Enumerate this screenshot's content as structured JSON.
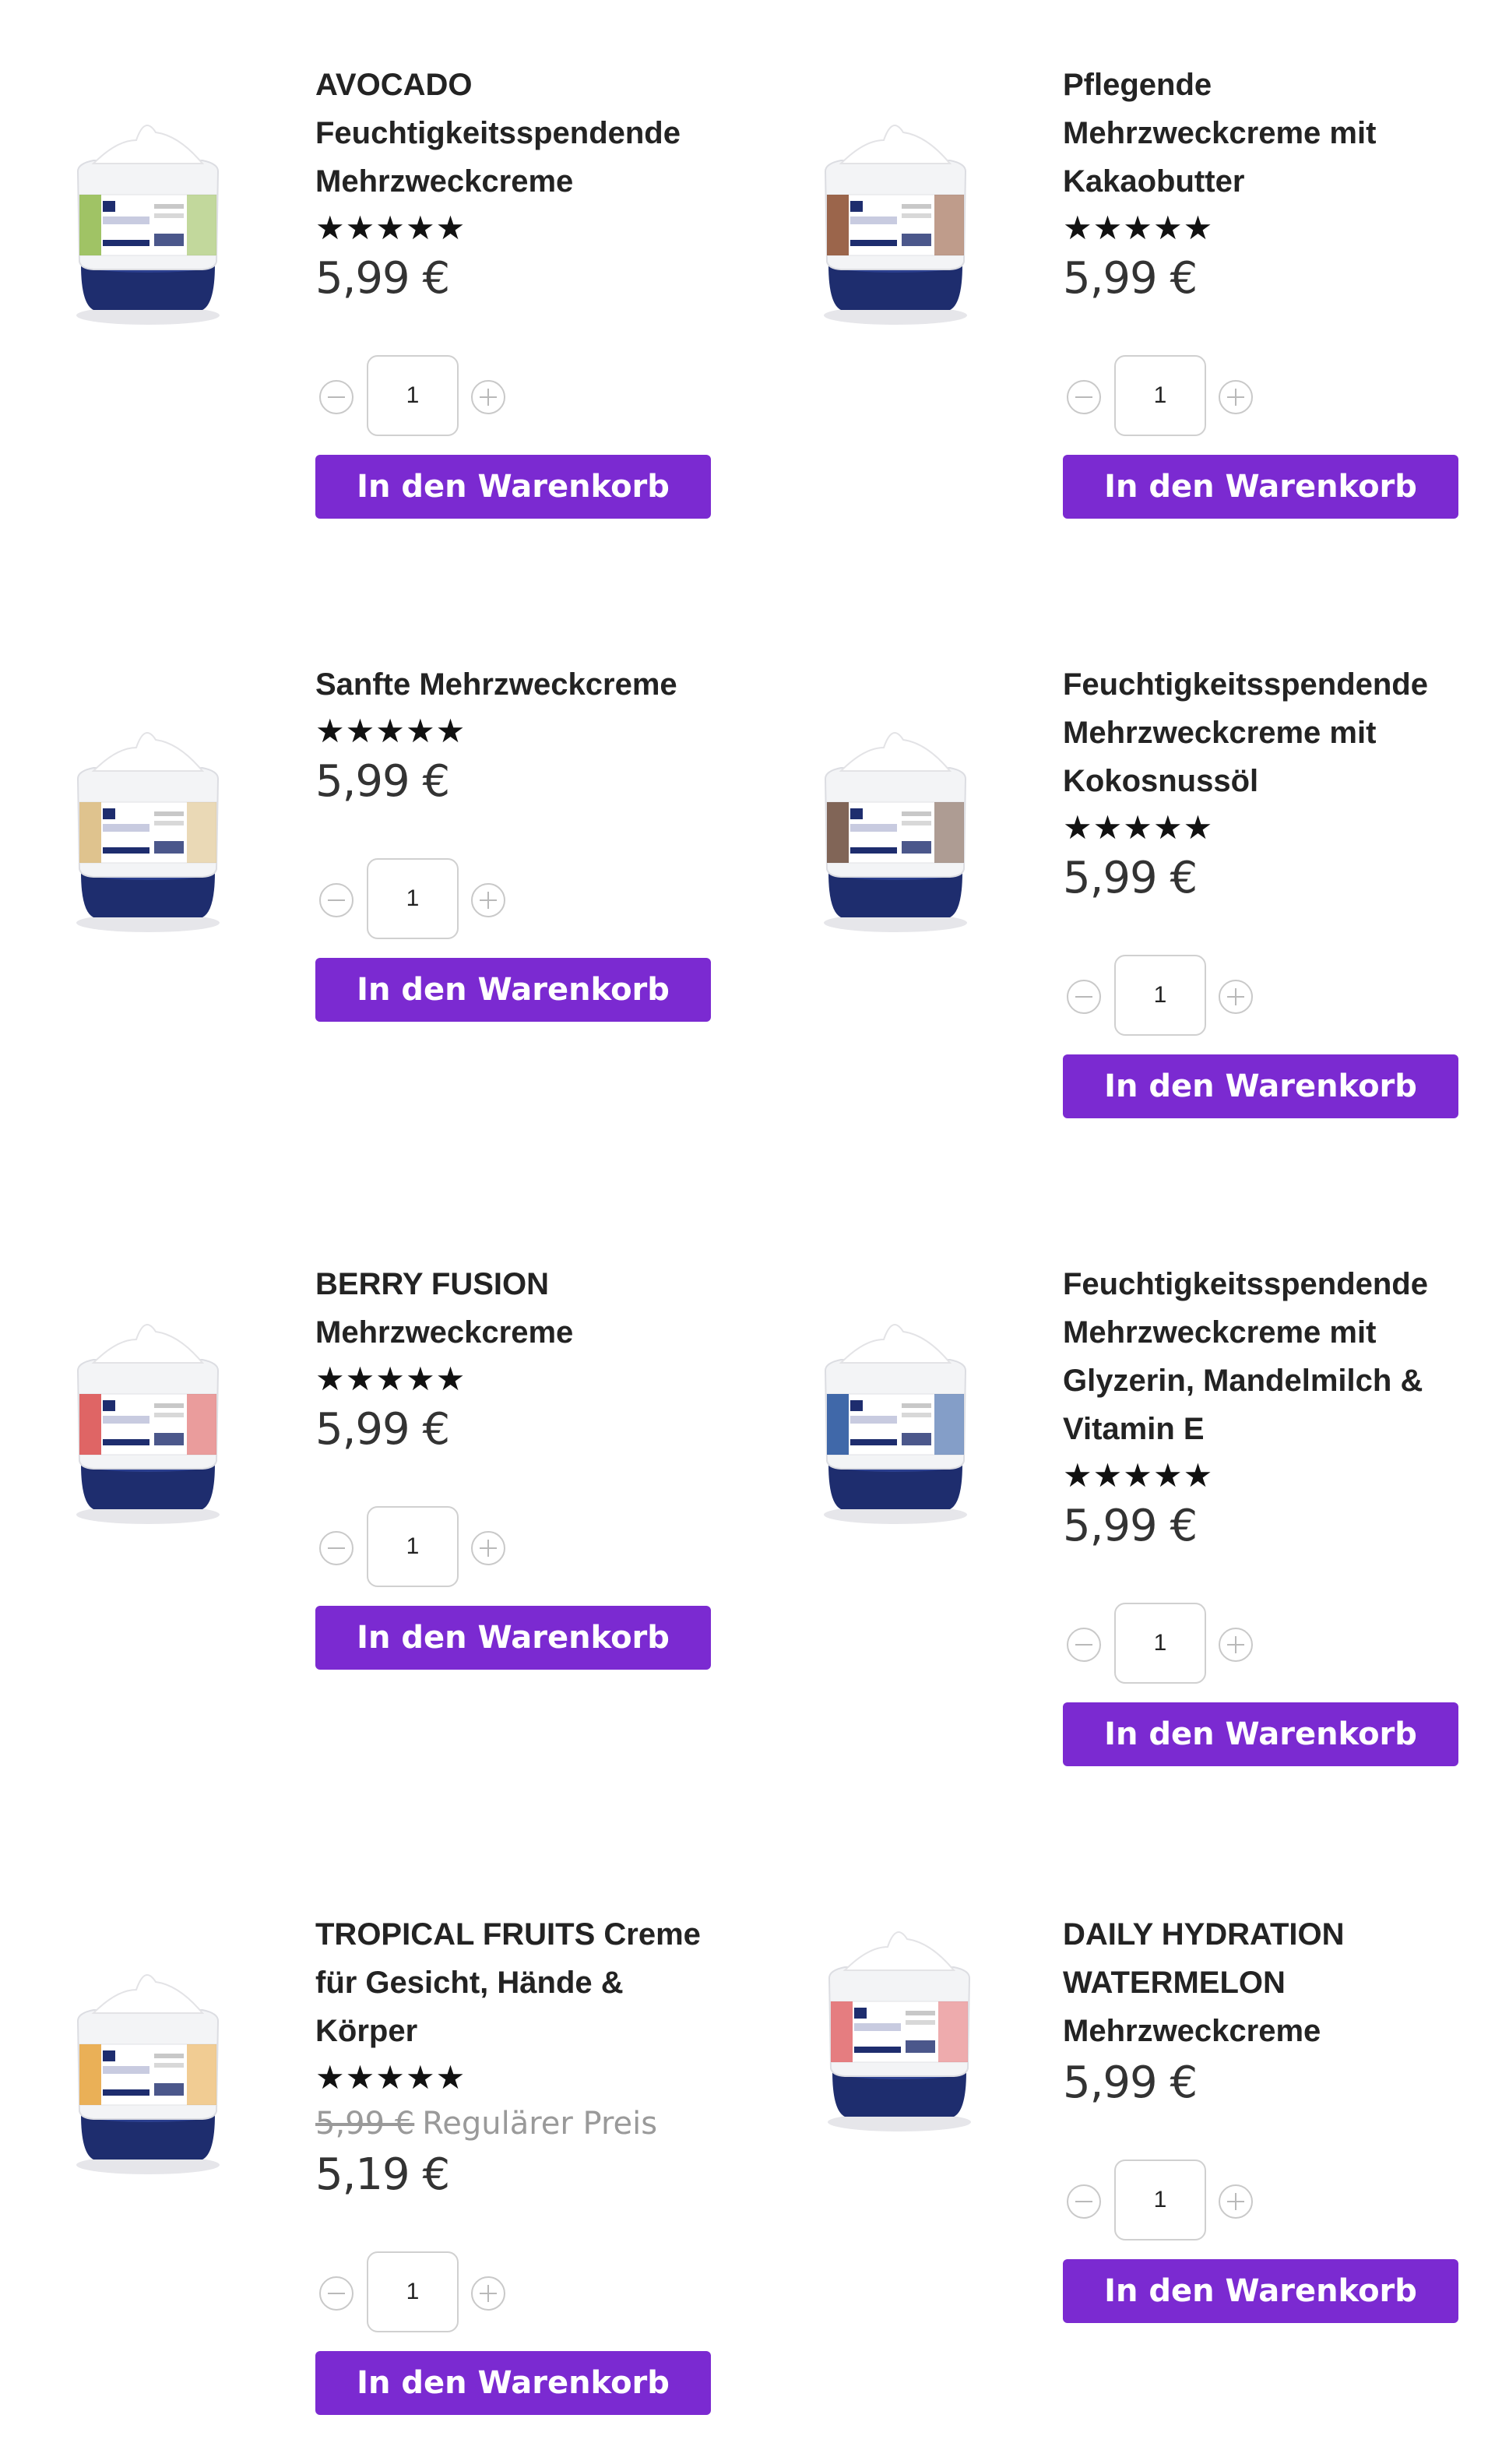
{
  "products": [
    {
      "title_lines": [
        "AVOCADO",
        "Feuchtigkeitsspendende",
        "Mehrzweckcreme"
      ],
      "stars": "★★★★★",
      "price": "5,99 €",
      "qty": "1",
      "cart_label": "In den Warenkorb",
      "label_color": "#8fb84a"
    },
    {
      "title_lines": [
        "Pflegende",
        "Mehrzweckcreme mit",
        "Kakaobutter"
      ],
      "stars": "★★★★★",
      "price": "5,99 €",
      "qty": "1",
      "cart_label": "In den Warenkorb",
      "label_color": "#8a4a2c"
    },
    {
      "title_lines": [
        "Sanfte Mehrzweckcreme"
      ],
      "stars": "★★★★★",
      "price": "5,99 €",
      "qty": "1",
      "cart_label": "In den Warenkorb",
      "label_color": "#d9b97a"
    },
    {
      "title_lines": [
        "Feuchtigkeitsspendende",
        "Mehrzweckcreme mit",
        "Kokosnussöl"
      ],
      "stars": "★★★★★",
      "price": "5,99 €",
      "qty": "1",
      "cart_label": "In den Warenkorb",
      "label_color": "#6b4a3a"
    },
    {
      "title_lines": [
        "BERRY FUSION",
        "Mehrzweckcreme"
      ],
      "stars": "★★★★★",
      "price": "5,99 €",
      "qty": "1",
      "cart_label": "In den Warenkorb",
      "label_color": "#d94a4a"
    },
    {
      "title_lines": [
        "Feuchtigkeitsspendende",
        "Mehrzweckcreme mit",
        "Glyzerin, Mandelmilch &",
        "Vitamin E"
      ],
      "stars": "★★★★★",
      "price": "5,99 €",
      "qty": "1",
      "cart_label": "In den Warenkorb",
      "label_color": "#1f4e9a"
    },
    {
      "title_lines": [
        "TROPICAL FRUITS Creme",
        "für Gesicht, Hände &",
        "Körper"
      ],
      "stars": "★★★★★",
      "old_price": "5,99 €",
      "old_price_label": "Regulärer Preis",
      "price": "5,19 €",
      "qty": "1",
      "cart_label": "In den Warenkorb",
      "label_color": "#e6a23a"
    },
    {
      "title_lines": [
        "DAILY HYDRATION",
        "WATERMELON",
        "Mehrzweckcreme"
      ],
      "price": "5,99 €",
      "qty": "1",
      "cart_label": "In den Warenkorb",
      "label_color": "#e0666a"
    }
  ]
}
